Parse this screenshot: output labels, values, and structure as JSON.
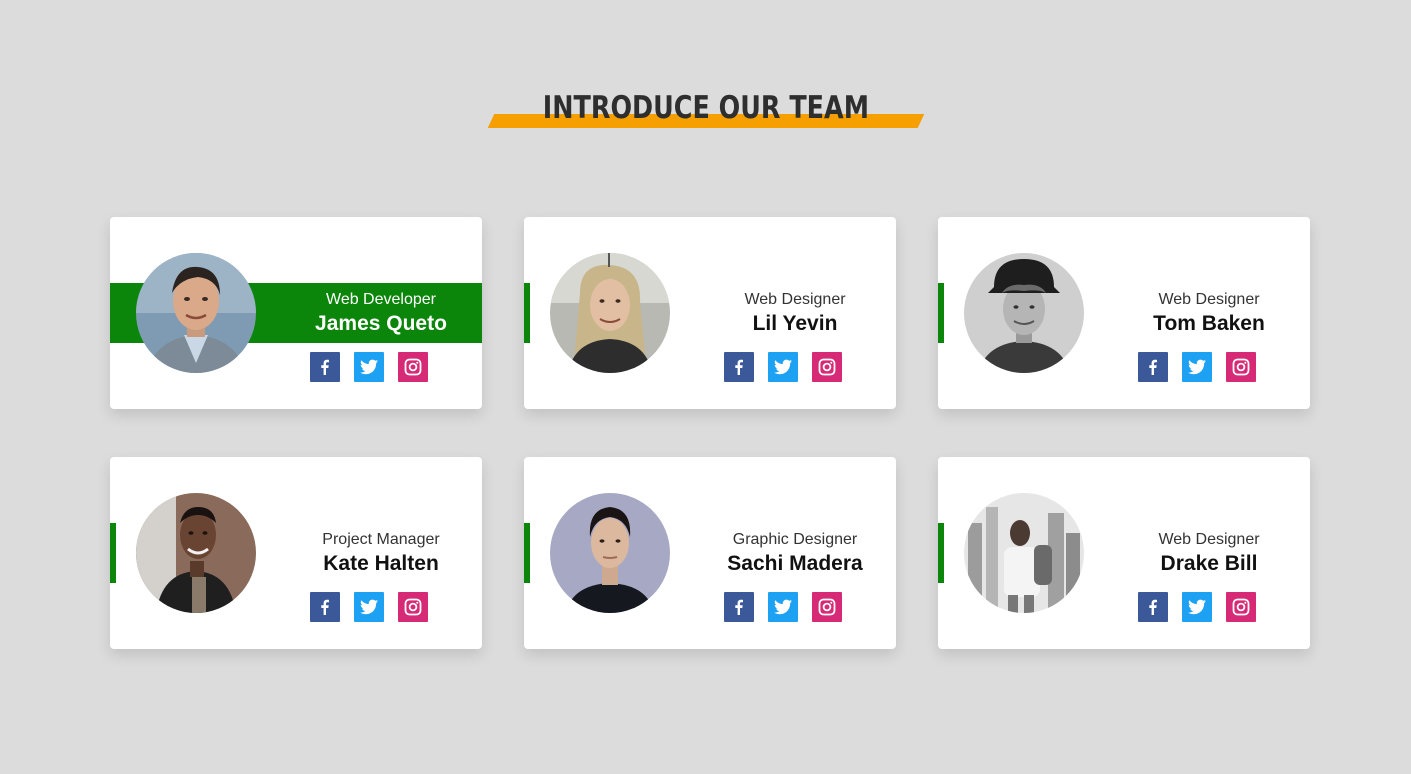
{
  "page": {
    "title": "INTRODUCE OUR TEAM",
    "accent_color": "#f5a000",
    "band_color": "#0b860b"
  },
  "social_icons": [
    "facebook-icon",
    "twitter-icon",
    "instagram-icon"
  ],
  "team": [
    {
      "role": "Web Developer",
      "name": "James Queto",
      "active": true
    },
    {
      "role": "Web Designer",
      "name": "Lil Yevin",
      "active": false
    },
    {
      "role": "Web Designer",
      "name": "Tom Baken",
      "active": false
    },
    {
      "role": "Project Manager",
      "name": "Kate Halten",
      "active": false
    },
    {
      "role": "Graphic Designer",
      "name": "Sachi Madera",
      "active": false
    },
    {
      "role": "Web Designer",
      "name": "Drake Bill",
      "active": false
    }
  ]
}
